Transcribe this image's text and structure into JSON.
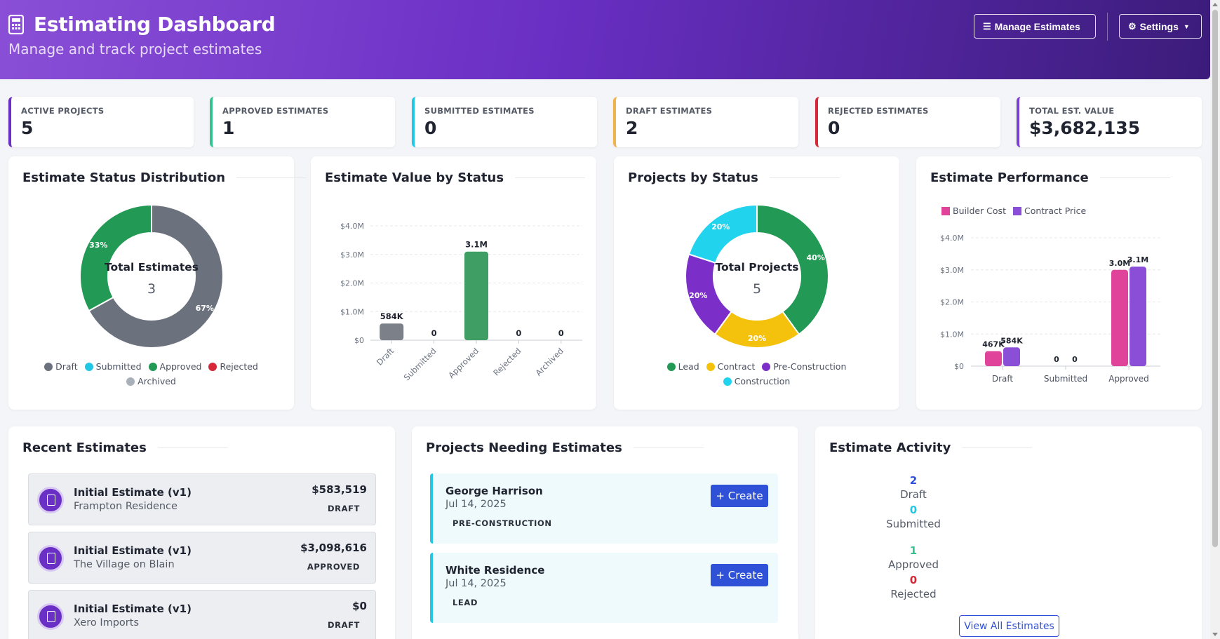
{
  "header": {
    "title": "Estimating Dashboard",
    "subtitle": "Manage and track project estimates",
    "manage_label": "Manage Estimates",
    "settings_label": "Settings",
    "icon": "calculator-icon"
  },
  "stats": [
    {
      "label": "ACTIVE PROJECTS",
      "value": "5",
      "color": "#6a2fc4"
    },
    {
      "label": "APPROVED ESTIMATES",
      "value": "1",
      "color": "#34c38f"
    },
    {
      "label": "SUBMITTED ESTIMATES",
      "value": "0",
      "color": "#22c7e3"
    },
    {
      "label": "DRAFT ESTIMATES",
      "value": "2",
      "color": "#f1b44c"
    },
    {
      "label": "REJECTED ESTIMATES",
      "value": "0",
      "color": "#d62839"
    },
    {
      "label": "TOTAL EST. VALUE",
      "value": "$3,682,135",
      "color": "#7b3fd1"
    }
  ],
  "panels": {
    "status_dist": "Estimate Status Distribution",
    "value_by_status": "Estimate Value by Status",
    "projects_by_status": "Projects by Status",
    "performance": "Estimate Performance",
    "recent": "Recent Estimates",
    "needing": "Projects Needing Estimates",
    "activity": "Estimate Activity"
  },
  "chart_data": [
    {
      "type": "pie",
      "title": "Estimate Status Distribution",
      "center_label": "Total Estimates",
      "center_value": "3",
      "slices": [
        {
          "name": "Draft",
          "value": 67,
          "label": "67%",
          "color": "#6c727d"
        },
        {
          "name": "Approved",
          "value": 33,
          "label": "33%",
          "color": "#229954"
        }
      ],
      "legend": [
        {
          "name": "Draft",
          "color": "#6c727d"
        },
        {
          "name": "Submitted",
          "color": "#22c7e3"
        },
        {
          "name": "Approved",
          "color": "#229954"
        },
        {
          "name": "Rejected",
          "color": "#d62839"
        },
        {
          "name": "Archived",
          "color": "#aab0ba"
        }
      ]
    },
    {
      "type": "bar",
      "title": "Estimate Value by Status",
      "categories": [
        "Draft",
        "Submitted",
        "Approved",
        "Rejected",
        "Archived"
      ],
      "values": [
        583519,
        0,
        3098616,
        0,
        0
      ],
      "data_labels": [
        "584K",
        "0",
        "3.1M",
        "0",
        "0"
      ],
      "colors": [
        "#7b8089",
        "#22c7e3",
        "#3e9e63",
        "#d62839",
        "#aab0ba"
      ],
      "yticks": [
        "$0",
        "$1.0M",
        "$2.0M",
        "$3.0M",
        "$4.0M"
      ],
      "ylim": [
        0,
        4000000
      ]
    },
    {
      "type": "pie",
      "title": "Projects by Status",
      "center_label": "Total Projects",
      "center_value": "5",
      "slices": [
        {
          "name": "Lead",
          "value": 40,
          "label": "40%",
          "color": "#229954"
        },
        {
          "name": "Contract",
          "value": 20,
          "label": "20%",
          "color": "#f4c20d"
        },
        {
          "name": "Pre-Construction",
          "value": 20,
          "label": "20%",
          "color": "#7b2fc8"
        },
        {
          "name": "Construction",
          "value": 20,
          "label": "20%",
          "color": "#22d3ee"
        }
      ],
      "legend": [
        {
          "name": "Lead",
          "color": "#229954"
        },
        {
          "name": "Contract",
          "color": "#f4c20d"
        },
        {
          "name": "Pre-Construction",
          "color": "#7b2fc8"
        },
        {
          "name": "Construction",
          "color": "#22d3ee"
        }
      ]
    },
    {
      "type": "bar",
      "title": "Estimate Performance",
      "categories": [
        "Draft",
        "Submitted",
        "Approved"
      ],
      "series": [
        {
          "name": "Builder Cost",
          "values": [
            467000,
            0,
            3000000
          ],
          "labels": [
            "467K",
            "0",
            "3.0M"
          ],
          "color": "#e0449a"
        },
        {
          "name": "Contract Price",
          "values": [
            584000,
            0,
            3100000
          ],
          "labels": [
            "584K",
            "0",
            "3.1M"
          ],
          "color": "#8a4fd6"
        }
      ],
      "yticks": [
        "$0",
        "$1.0M",
        "$2.0M",
        "$3.0M",
        "$4.0M"
      ],
      "ylim": [
        0,
        4000000
      ]
    }
  ],
  "recent": [
    {
      "name": "Initial Estimate (v1)",
      "project": "Frampton Residence",
      "amount": "$583,519",
      "status": "DRAFT"
    },
    {
      "name": "Initial Estimate (v1)",
      "project": "The Village on Blain",
      "amount": "$3,098,616",
      "status": "APPROVED"
    },
    {
      "name": "Initial Estimate (v1)",
      "project": "Xero Imports",
      "amount": "$0",
      "status": "DRAFT"
    }
  ],
  "needing": [
    {
      "name": "George Harrison",
      "date": "Jul 14, 2025",
      "badge": "PRE-CONSTRUCTION",
      "button": "+ Create"
    },
    {
      "name": "White Residence",
      "date": "Jul 14, 2025",
      "badge": "LEAD",
      "button": "+ Create"
    }
  ],
  "activity": {
    "items": [
      {
        "value": "2",
        "label": "Draft",
        "color": "#2f51d8"
      },
      {
        "value": "0",
        "label": "Submitted",
        "color": "#22c7e3"
      },
      {
        "value": "1",
        "label": "Approved",
        "color": "#34c38f"
      },
      {
        "value": "0",
        "label": "Rejected",
        "color": "#d62839"
      }
    ],
    "view_all": "View All Estimates"
  }
}
